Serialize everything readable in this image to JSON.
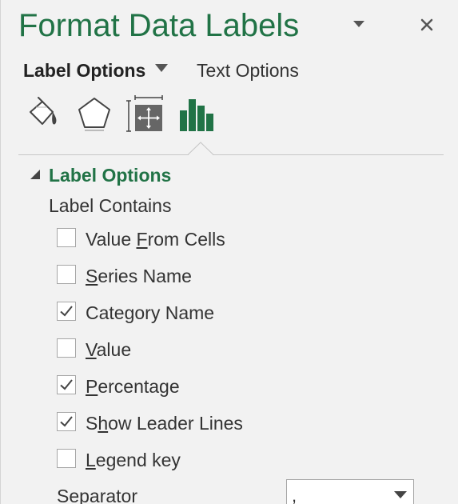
{
  "pane": {
    "title": "Format Data Labels",
    "accent_color": "#217346"
  },
  "tabs": [
    {
      "label": "Label Options",
      "selected": true
    },
    {
      "label": "Text Options",
      "selected": false
    }
  ],
  "icon_tabs": [
    {
      "name": "fill-line-icon",
      "selected": false
    },
    {
      "name": "effects-icon",
      "selected": false
    },
    {
      "name": "size-properties-icon",
      "selected": false
    },
    {
      "name": "label-options-chart-icon",
      "selected": true
    }
  ],
  "section": {
    "title": "Label Options",
    "expanded": true,
    "group_label": "Label Contains"
  },
  "options": [
    {
      "pre": "Value ",
      "key": "F",
      "post": "rom Cells",
      "checked": false
    },
    {
      "pre": "",
      "key": "S",
      "post": "eries Name",
      "checked": false
    },
    {
      "pre": "Cate",
      "key": "g",
      "post": "ory Name",
      "checked": true
    },
    {
      "pre": "",
      "key": "V",
      "post": "alue",
      "checked": false
    },
    {
      "pre": "",
      "key": "P",
      "post": "ercentage",
      "checked": true
    },
    {
      "pre": "S",
      "key": "h",
      "post": "ow Leader Lines",
      "checked": true
    },
    {
      "pre": "",
      "key": "L",
      "post": "egend key",
      "checked": false
    }
  ],
  "separator": {
    "label": "Separator",
    "value": ","
  }
}
